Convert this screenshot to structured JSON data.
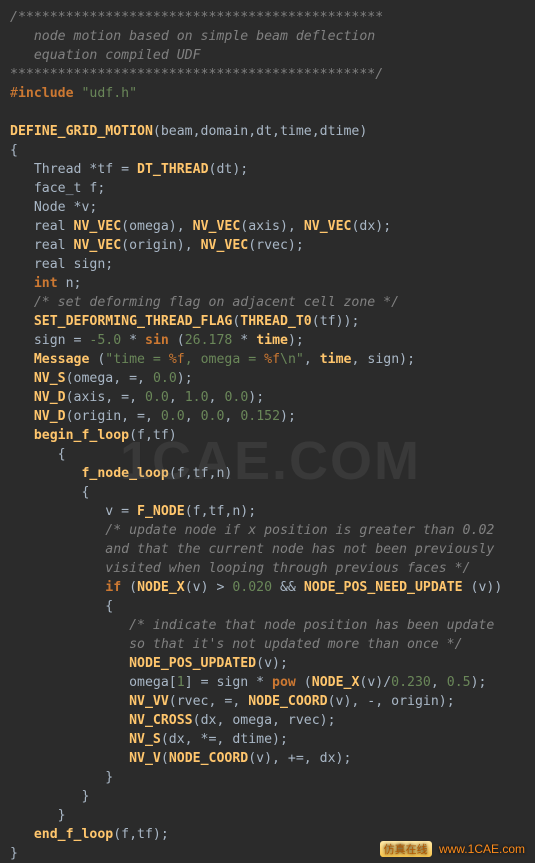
{
  "code": {
    "lines": [
      {
        "t": "cmt",
        "text": "/**********************************************"
      },
      {
        "t": "cmt",
        "text": "   node motion based on simple beam deflection"
      },
      {
        "t": "cmt",
        "text": "   equation compiled UDF"
      },
      {
        "t": "cmt",
        "text": "**********************************************/"
      },
      {
        "t": "inc",
        "pre": "#",
        "kw": "include",
        "str": "\"udf.h\""
      },
      {
        "t": "blank"
      },
      {
        "t": "defgrid",
        "fn": "DEFINE_GRID_MOTION",
        "args": "(beam,domain,dt,time,dtime)"
      },
      {
        "t": "plain",
        "text": "{"
      },
      {
        "t": "decl1",
        "indent": 1,
        "lead": "Thread *tf = ",
        "fn": "DT_THREAD",
        "tail": "(dt);"
      },
      {
        "t": "plain",
        "indent": 1,
        "text": "face_t f;"
      },
      {
        "t": "plain",
        "indent": 1,
        "text": "Node *v;"
      },
      {
        "t": "nvvec3",
        "indent": 1,
        "lead": "real ",
        "a": "omega",
        "b": "axis",
        "c": "dx"
      },
      {
        "t": "nvvec2",
        "indent": 1,
        "lead": "real ",
        "a": "origin",
        "b": "rvec"
      },
      {
        "t": "plain",
        "indent": 1,
        "text": "real sign;"
      },
      {
        "t": "intn",
        "indent": 1,
        "kw": "int",
        "text": " n;"
      },
      {
        "t": "cmt",
        "indent": 1,
        "text": "/* set deforming flag on adjacent cell zone */"
      },
      {
        "t": "call2",
        "indent": 1,
        "fn": "SET_DEFORMING_THREAD_FLAG",
        "fn2": "THREAD_T0",
        "arg2": "tf"
      },
      {
        "t": "sign",
        "indent": 1,
        "n1": "-5.0",
        "kw": "sin",
        "n2": "26.178",
        "id": "time"
      },
      {
        "t": "msg",
        "indent": 1,
        "fn": "Message",
        "s1": "\"time = ",
        "f1": "%f",
        "s2": ", omega = ",
        "f2": "%f",
        "s3": "\\n\"",
        "a1": "time",
        "a2": "sign"
      },
      {
        "t": "nvs",
        "indent": 1,
        "fn": "NV_S",
        "a": "omega",
        "n": "0.0"
      },
      {
        "t": "nvd3",
        "indent": 1,
        "fn": "NV_D",
        "a": "axis",
        "n1": "0.0",
        "n2": "1.0",
        "n3": "0.0"
      },
      {
        "t": "nvd3",
        "indent": 1,
        "fn": "NV_D",
        "a": "origin",
        "n1": "0.0",
        "n2": "0.0",
        "n3": "0.152"
      },
      {
        "t": "begin",
        "indent": 1,
        "fn": "begin_f_loop",
        "args": "(f,tf)"
      },
      {
        "t": "plain",
        "indent": 2,
        "text": "{"
      },
      {
        "t": "call",
        "indent": 3,
        "fn": "f_node_loop",
        "args": "(f,tf,n)"
      },
      {
        "t": "plain",
        "indent": 3,
        "text": "{"
      },
      {
        "t": "fnode",
        "indent": 4,
        "lead": "v = ",
        "fn": "F_NODE",
        "args": "(f,tf,n);"
      },
      {
        "t": "cmt",
        "indent": 4,
        "text": "/* update node if x position is greater than 0.02"
      },
      {
        "t": "cmt",
        "indent": 4,
        "text": "and that the current node has not been previously"
      },
      {
        "t": "cmt",
        "indent": 4,
        "text": "visited when looping through previous faces */"
      },
      {
        "t": "if",
        "indent": 4,
        "kw": "if",
        "fn1": "NODE_X",
        "n": "0.020",
        "fn2": "NODE_POS_NEED_UPDATE"
      },
      {
        "t": "plain",
        "indent": 4,
        "text": "{"
      },
      {
        "t": "cmt",
        "indent": 5,
        "text": "/* indicate that node position has been update"
      },
      {
        "t": "cmt",
        "indent": 5,
        "text": "so that it's not updated more than once */"
      },
      {
        "t": "call",
        "indent": 5,
        "fn": "NODE_POS_UPDATED",
        "args": "(v);"
      },
      {
        "t": "omega",
        "indent": 5,
        "idx": "1",
        "kw": "pow",
        "fn": "NODE_X",
        "n1": "0.230",
        "n2": "0.5"
      },
      {
        "t": "nvvv",
        "indent": 5,
        "fn": "NV_VV",
        "fn2": "NODE_COORD"
      },
      {
        "t": "call",
        "indent": 5,
        "fn": "NV_CROSS",
        "args": "(dx, omega, rvec);"
      },
      {
        "t": "call",
        "indent": 5,
        "fn": "NV_S",
        "args": "(dx, *=, dtime);"
      },
      {
        "t": "nvv",
        "indent": 5,
        "fn": "NV_V",
        "fn2": "NODE_COORD"
      },
      {
        "t": "plain",
        "indent": 4,
        "text": "}"
      },
      {
        "t": "plain",
        "indent": 3,
        "text": "}"
      },
      {
        "t": "plain",
        "indent": 2,
        "text": "}"
      },
      {
        "t": "call",
        "indent": 1,
        "fn": "end_f_loop",
        "args": "(f,tf);"
      },
      {
        "t": "plain",
        "indent": 0,
        "text": "}"
      }
    ]
  },
  "watermark": "1CAE.COM",
  "footer": {
    "cn": "仿真在线",
    "url": "www.1CAE.com"
  }
}
